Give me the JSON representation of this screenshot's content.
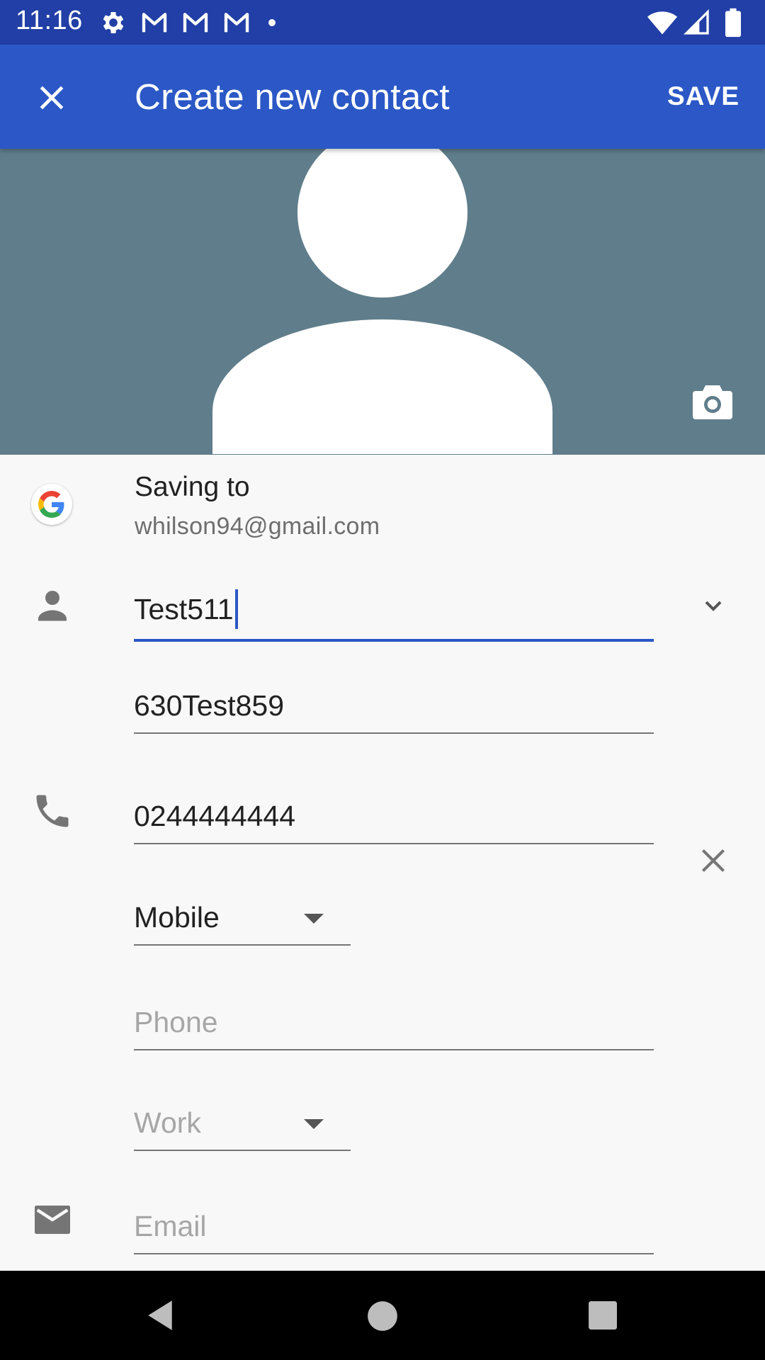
{
  "status_bar": {
    "time": "11:16",
    "left_icons": [
      "settings-icon",
      "gmail-icon",
      "gmail-icon",
      "gmail-icon",
      "dot-icon"
    ],
    "right_icons": [
      "wifi-icon",
      "cell-signal-icon",
      "battery-icon"
    ]
  },
  "app_bar": {
    "title": "Create new contact",
    "save_label": "SAVE",
    "close_icon": "close-icon",
    "background": "#2b58c6"
  },
  "photo": {
    "background": "#607d8b",
    "camera_icon": "camera-icon"
  },
  "account": {
    "label": "Saving to",
    "email": "whilson94@gmail.com"
  },
  "fields": {
    "name": {
      "value": "Test511"
    },
    "last_name": {
      "value": "630Test859"
    },
    "phone": {
      "value": "0244444444"
    },
    "phone_type": {
      "value": "Mobile"
    },
    "phone2": {
      "placeholder": "Phone"
    },
    "phone2_type": {
      "placeholder": "Work"
    },
    "email": {
      "placeholder": "Email"
    }
  },
  "nav_bar": {
    "items": [
      "back-icon",
      "home-icon",
      "recents-icon"
    ]
  },
  "colors": {
    "status_bar": "#213fa6",
    "accent": "#2b58c6"
  }
}
